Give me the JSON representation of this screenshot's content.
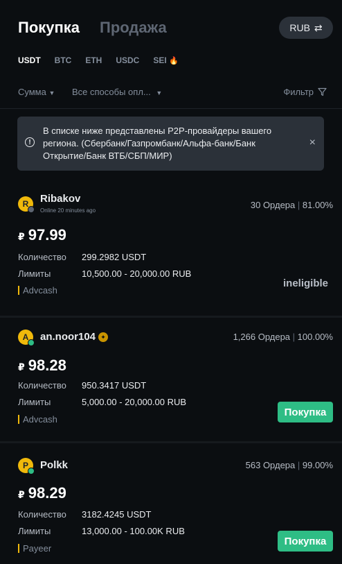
{
  "header": {
    "buy_tab": "Покупка",
    "sell_tab": "Продажа",
    "currency": "RUB",
    "swap_icon": "⇄"
  },
  "coins": [
    "USDT",
    "BTC",
    "ETH",
    "USDC",
    "SEI"
  ],
  "hot_icon": "🔥",
  "filters": {
    "amount": "Сумма",
    "payment": "Все способы опл...",
    "filter": "Фильтр"
  },
  "notice": {
    "text": "В списке ниже представлены P2P-провайдеры вашего региона. (Сбербанк/Газпромбанк/Альфа-банк/Банк Открытие/Банк ВТБ/СБП/МИР)",
    "close": "×",
    "info": "!"
  },
  "labels": {
    "quantity": "Количество",
    "limits": "Лимиты",
    "currency_symbol": "₽"
  },
  "offers": [
    {
      "initial": "R",
      "name": "Ribakov",
      "online": "Online 20 minutes ago",
      "orders": "30 Ордера",
      "completion": "81.00%",
      "price": "97.99",
      "quantity": "299.2982 USDT",
      "limits": "10,500.00 - 20,000.00 RUB",
      "method": "Advcash",
      "action": "ineligible",
      "status_color": "#5e6673"
    },
    {
      "initial": "A",
      "name": "an.noor104",
      "orders": "1,266 Ордера",
      "completion": "100.00%",
      "price": "98.28",
      "quantity": "950.3417 USDT",
      "limits": "5,000.00 - 20,000.00 RUB",
      "method": "Advcash",
      "action": "Покупка",
      "status_color": "#2ebd85"
    },
    {
      "initial": "P",
      "name": "Polkk",
      "orders": "563 Ордера",
      "completion": "99.00%",
      "price": "98.29",
      "quantity": "3182.4245 USDT",
      "limits": "13,000.00 - 100.00K RUB",
      "method": "Payeer",
      "action": "Покупка",
      "status_color": "#2ebd85"
    }
  ],
  "colors": {
    "accent": "#f0b90b",
    "buy": "#2ebd85",
    "background": "#0b0e11"
  }
}
